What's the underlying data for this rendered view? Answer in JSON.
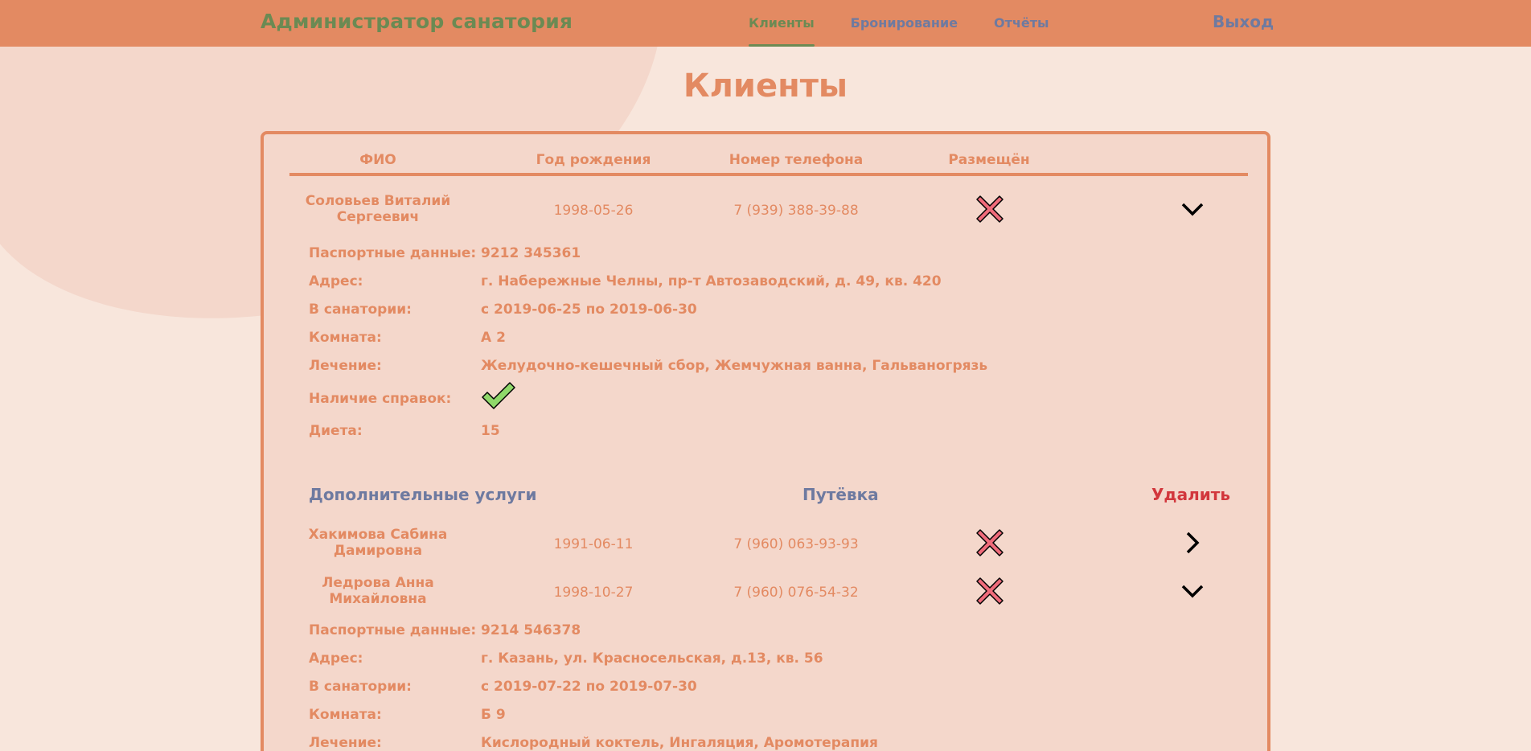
{
  "header": {
    "brand": "Администратор санатория",
    "nav": [
      "Клиенты",
      "Бронирование",
      "Отчёты"
    ],
    "logout": "Выход"
  },
  "page_title": "Клиенты",
  "table": {
    "columns": [
      "ФИО",
      "Год рождения",
      "Номер телефона",
      "Размещён"
    ],
    "rows": [
      {
        "name": "Соловьев Виталий Сергеевич",
        "birth": "1998-05-26",
        "phone": "7 (939) 388-39-88",
        "placed_icon": "cross-icon",
        "expand_icon": "chevron-down-icon",
        "expanded": true,
        "details": {
          "passport_label": "Паспортные данные:",
          "passport": "9212 345361",
          "address_label": "Адрес:",
          "address": "г. Набережные Челны, пр-т Автозаводский, д. 49, кв. 420",
          "stay_label": "В санатории:",
          "stay": "с 2019-06-25  по 2019-06-30",
          "room_label": "Комната:",
          "room": "А  2",
          "treatment_label": "Лечение:",
          "treatment": "Желудочно-кешечный сбор, Жемчужная ванна, Гальваногрязь",
          "certs_label": "Наличие справок:",
          "certs_icon": "checkmark-icon",
          "diet_label": "Диета:",
          "diet": "15"
        },
        "actions": {
          "extra_services": "Дополнительные услуги",
          "voucher": "Путёвка",
          "delete": "Удалить"
        }
      },
      {
        "name": "Хакимова Сабина Дамировна",
        "birth": "1991-06-11",
        "phone": "7 (960) 063-93-93",
        "placed_icon": "cross-icon",
        "expand_icon": "chevron-right-icon",
        "expanded": false
      },
      {
        "name": "Ледрова Анна Михайловна",
        "birth": "1998-10-27",
        "phone": "7 (960) 076-54-32",
        "placed_icon": "cross-icon",
        "expand_icon": "chevron-down-icon",
        "expanded": true,
        "details": {
          "passport_label": "Паспортные данные:",
          "passport": "9214 546378",
          "address_label": "Адрес:",
          "address": "г. Казань, ул. Красносельская, д.13, кв. 56",
          "stay_label": "В санатории:",
          "stay": "с 2019-07-22  по 2019-07-30",
          "room_label": "Комната:",
          "room": "Б  9",
          "treatment_label": "Лечение:",
          "treatment": "Кислородный коктель, Ингаляция, Аромотерапия"
        }
      }
    ]
  },
  "colors": {
    "header_bg": "#e38a62",
    "accent": "#e38a62",
    "brand_green": "#6b8a53",
    "nav_blue": "#6e7aa0",
    "delete_red": "#d2373c",
    "cross_fill": "#ef6b7a",
    "check_fill": "#8fd86a"
  }
}
